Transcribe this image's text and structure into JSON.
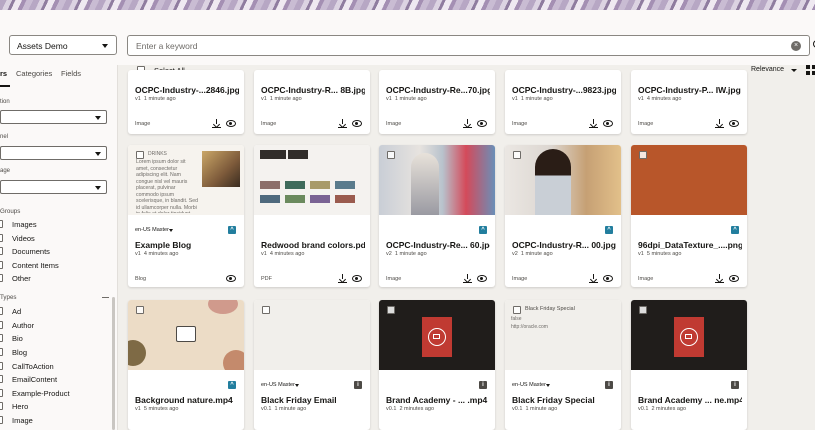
{
  "repository": {
    "selected": "Assets Demo"
  },
  "search": {
    "placeholder": "Enter a keyword",
    "value": ""
  },
  "sidebar": {
    "tabs": [
      "rs",
      "Categories",
      "Fields"
    ],
    "collection_label": "tion",
    "channel_label": "nel",
    "language_label": "age",
    "groups_header": "Groups",
    "groups": [
      "Images",
      "Videos",
      "Documents",
      "Content Items",
      "Other"
    ],
    "types_header": "Types",
    "types": [
      "Ad",
      "Author",
      "Bio",
      "Blog",
      "CallToAction",
      "EmailContent",
      "Example-Product",
      "Hero",
      "Image"
    ]
  },
  "toolbar": {
    "select_all": "Select All",
    "sort": "Relevance"
  },
  "colors": {
    "published": "#227e9e",
    "draft": "#4d4a46",
    "accent": "#161513"
  },
  "row1": [
    {
      "title": "OCPC-Industry-...2846.jpg",
      "version": "v1",
      "age": "1 minute ago",
      "type": "Image"
    },
    {
      "title": "OCPC-Industry-R... 8B.jpg",
      "version": "v1",
      "age": "1 minute ago",
      "type": "Image"
    },
    {
      "title": "OCPC-Industry-Re...70.jpg",
      "version": "v1",
      "age": "1 minute ago",
      "type": "Image"
    },
    {
      "title": "OCPC-Industry-...9823.jpg",
      "version": "v1",
      "age": "1 minute ago",
      "type": "Image"
    },
    {
      "title": "OCPC-Industry-P... IW.jpg",
      "version": "v1",
      "age": "4 minutes ago",
      "type": "Image"
    }
  ],
  "row2": [
    {
      "lang": "en-US Master",
      "title": "Example Blog",
      "version": "v1",
      "age": "4 minutes ago",
      "type": "Blog",
      "thumb_tag": "DRINKS",
      "thumb_text": "Lorem ipsum dolor sit amet, consectetur adipiscing elit. Nam congue nisl vel mauris placerat, pulvinar commodo ipsum scelerisque, in blandit. Sed id ullamcorper nulla. Morbi in felis et dolor tincidunt, dignissim ante elit"
    },
    {
      "title": "Redwood brand colors.pdf",
      "version": "v1",
      "age": "4 minutes ago",
      "type": "PDF"
    },
    {
      "title": "OCPC-Industry-Re... 60.jpg",
      "version": "v2",
      "age": "1 minute ago",
      "type": "Image"
    },
    {
      "title": "OCPC-Industry-R... 00.jpg",
      "version": "v2",
      "age": "1 minute ago",
      "type": "Image"
    },
    {
      "title": "96dpi_DataTexture_....png",
      "version": "v1",
      "age": "5 minutes ago",
      "type": "Image"
    }
  ],
  "row3": [
    {
      "title": "Background nature.mp4",
      "version": "v1",
      "age": "5 minutes ago"
    },
    {
      "lang": "en-US Master",
      "title": "Black Friday Email",
      "version": "v0.1",
      "age": "1 minute ago"
    },
    {
      "title": "Brand Academy - ... .mp4",
      "version": "v0.1",
      "age": "2 minutes ago"
    },
    {
      "lang": "en-US Master",
      "title": "Black Friday Special",
      "version": "v0.1",
      "age": "1 minute ago",
      "thumb_tag": "Black Friday Special",
      "thumb_line1": "false",
      "thumb_line2": "http://oracle.com"
    },
    {
      "title": "Brand Academy ... ne.mp4",
      "version": "v0.1",
      "age": "2 minutes ago"
    }
  ]
}
